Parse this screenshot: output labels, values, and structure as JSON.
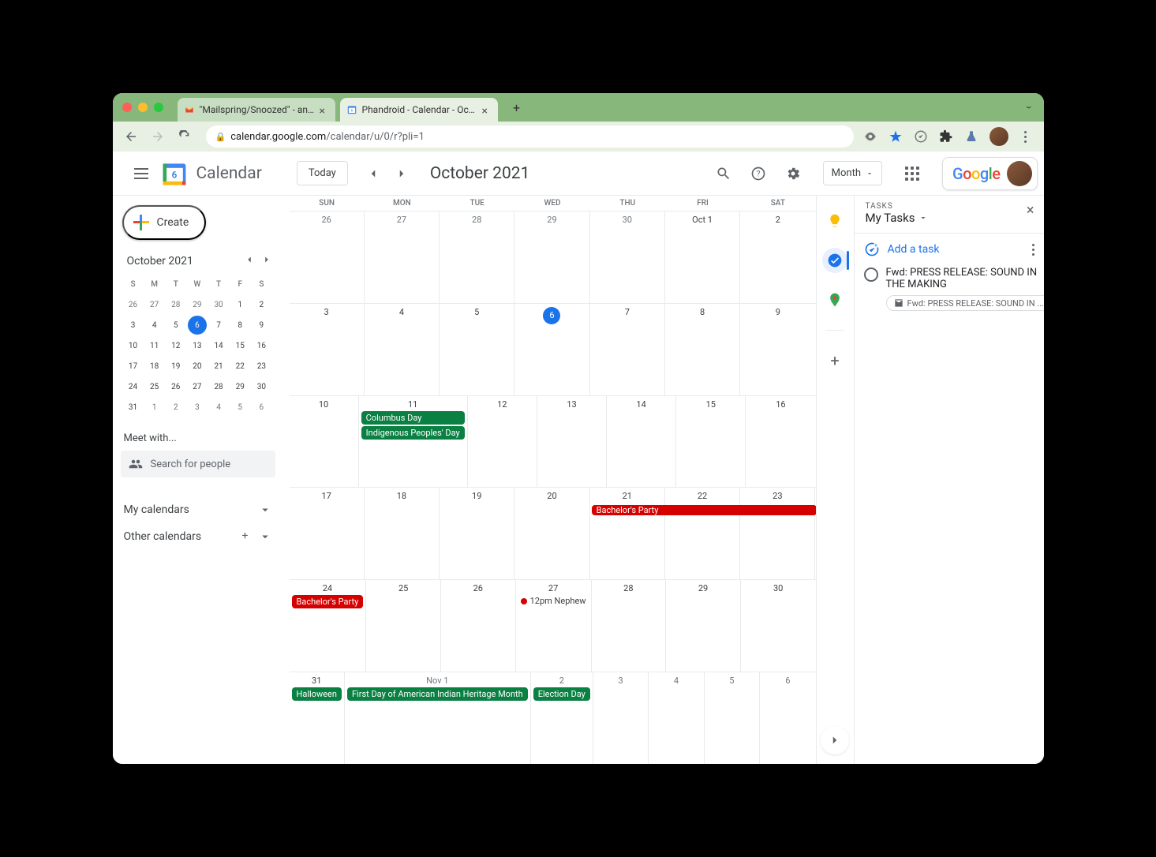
{
  "browser": {
    "tabs": [
      {
        "title": "\"Mailspring/Snoozed\" - andrew"
      },
      {
        "title": "Phandroid - Calendar - October"
      }
    ],
    "url_host": "calendar.google.com",
    "url_path": "/calendar/u/0/r?pli=1"
  },
  "header": {
    "app_title": "Calendar",
    "today": "Today",
    "month_title": "October 2021",
    "view": "Month"
  },
  "sidebar": {
    "create": "Create",
    "mini_month": "October 2021",
    "dow": [
      "S",
      "M",
      "T",
      "W",
      "T",
      "F",
      "S"
    ],
    "mini_days": [
      {
        "n": "26",
        "om": true
      },
      {
        "n": "27",
        "om": true
      },
      {
        "n": "28",
        "om": true
      },
      {
        "n": "29",
        "om": true
      },
      {
        "n": "30",
        "om": true
      },
      {
        "n": "1"
      },
      {
        "n": "2"
      },
      {
        "n": "3"
      },
      {
        "n": "4"
      },
      {
        "n": "5"
      },
      {
        "n": "6",
        "today": true
      },
      {
        "n": "7"
      },
      {
        "n": "8"
      },
      {
        "n": "9"
      },
      {
        "n": "10"
      },
      {
        "n": "11"
      },
      {
        "n": "12"
      },
      {
        "n": "13"
      },
      {
        "n": "14"
      },
      {
        "n": "15"
      },
      {
        "n": "16"
      },
      {
        "n": "17"
      },
      {
        "n": "18"
      },
      {
        "n": "19"
      },
      {
        "n": "20"
      },
      {
        "n": "21"
      },
      {
        "n": "22"
      },
      {
        "n": "23"
      },
      {
        "n": "24"
      },
      {
        "n": "25"
      },
      {
        "n": "26"
      },
      {
        "n": "27"
      },
      {
        "n": "28"
      },
      {
        "n": "29"
      },
      {
        "n": "30"
      },
      {
        "n": "31"
      },
      {
        "n": "1",
        "om": true
      },
      {
        "n": "2",
        "om": true
      },
      {
        "n": "3",
        "om": true
      },
      {
        "n": "4",
        "om": true
      },
      {
        "n": "5",
        "om": true
      },
      {
        "n": "6",
        "om": true
      }
    ],
    "meet_with": "Meet with...",
    "search_placeholder": "Search for people",
    "my_calendars": "My calendars",
    "other_calendars": "Other calendars"
  },
  "grid": {
    "dow": [
      "SUN",
      "MON",
      "TUE",
      "WED",
      "THU",
      "FRI",
      "SAT"
    ],
    "weeks": [
      [
        {
          "n": "26",
          "om": true
        },
        {
          "n": "27",
          "om": true
        },
        {
          "n": "28",
          "om": true
        },
        {
          "n": "29",
          "om": true
        },
        {
          "n": "30",
          "om": true
        },
        {
          "n": "Oct 1"
        },
        {
          "n": "2"
        }
      ],
      [
        {
          "n": "3"
        },
        {
          "n": "4"
        },
        {
          "n": "5"
        },
        {
          "n": "6",
          "today": true
        },
        {
          "n": "7"
        },
        {
          "n": "8"
        },
        {
          "n": "9"
        }
      ],
      [
        {
          "n": "10"
        },
        {
          "n": "11",
          "events": [
            {
              "t": "Columbus Day",
              "c": "green"
            },
            {
              "t": "Indigenous Peoples' Day",
              "c": "green"
            }
          ]
        },
        {
          "n": "12"
        },
        {
          "n": "13"
        },
        {
          "n": "14"
        },
        {
          "n": "15"
        },
        {
          "n": "16"
        }
      ],
      [
        {
          "n": "17"
        },
        {
          "n": "18"
        },
        {
          "n": "19"
        },
        {
          "n": "20"
        },
        {
          "n": "21"
        },
        {
          "n": "22"
        },
        {
          "n": "23"
        }
      ],
      [
        {
          "n": "24",
          "events": [
            {
              "t": "Bachelor's Party",
              "c": "red"
            }
          ]
        },
        {
          "n": "25"
        },
        {
          "n": "26"
        },
        {
          "n": "27",
          "timed": {
            "time": "12pm",
            "t": "Nephew"
          }
        },
        {
          "n": "28"
        },
        {
          "n": "29"
        },
        {
          "n": "30"
        }
      ],
      [
        {
          "n": "31",
          "events": [
            {
              "t": "Halloween",
              "c": "green"
            }
          ]
        },
        {
          "n": "Nov 1",
          "om": true,
          "events": [
            {
              "t": "First Day of American Indian Heritage Month",
              "c": "green"
            }
          ]
        },
        {
          "n": "2",
          "om": true,
          "events": [
            {
              "t": "Election Day",
              "c": "green"
            }
          ]
        },
        {
          "n": "3",
          "om": true
        },
        {
          "n": "4",
          "om": true
        },
        {
          "n": "5",
          "om": true
        },
        {
          "n": "6",
          "om": true
        }
      ]
    ],
    "spans": [
      {
        "week": 3,
        "start": 4,
        "end": 6,
        "t": "Bachelor's Party",
        "c": "red"
      }
    ]
  },
  "tasks": {
    "label": "TASKS",
    "list_name": "My Tasks",
    "add": "Add a task",
    "items": [
      {
        "title": "Fwd: PRESS RELEASE: SOUND IN THE MAKING",
        "attach": "Fwd: PRESS RELEASE: SOUND IN ..."
      }
    ]
  }
}
